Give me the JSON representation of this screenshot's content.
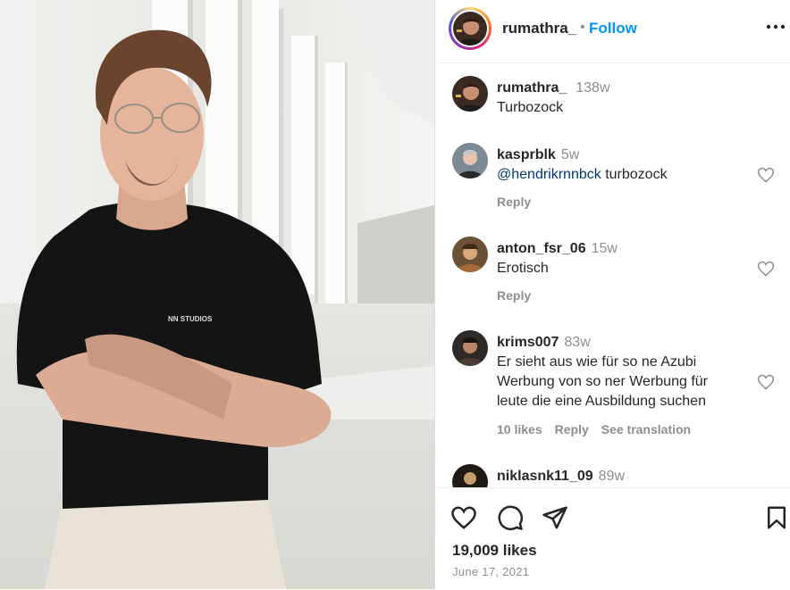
{
  "post": {
    "username": "rumathra_",
    "separator": "•",
    "follow_label": "Follow",
    "shirt_print": "NN STUDIOS"
  },
  "comments": [
    {
      "user": "rumathra_",
      "time": "138w",
      "mention": "",
      "text": "Turbozock",
      "likes": "",
      "reply": "",
      "translate": ""
    },
    {
      "user": "kasprblk",
      "time": "5w",
      "mention": "@hendrikrnnbck",
      "text": "turbozock",
      "likes": "",
      "reply": "Reply",
      "translate": ""
    },
    {
      "user": "anton_fsr_06",
      "time": "15w",
      "mention": "",
      "text": "Erotisch",
      "likes": "",
      "reply": "Reply",
      "translate": ""
    },
    {
      "user": "krims007",
      "time": "83w",
      "mention": "",
      "text": "Er sieht aus wie für so ne Azubi Werbung von so ner Werbung für leute die eine Ausbildung suchen",
      "likes": "10 likes",
      "reply": "Reply",
      "translate": "See translation"
    },
    {
      "user": "niklasnk11_09",
      "time": "89w",
      "mention": "",
      "text": "",
      "likes": "",
      "reply": "",
      "translate": ""
    }
  ],
  "footer": {
    "likes": "19,009 likes",
    "date": "June 17, 2021"
  },
  "icons": [
    "more-icon",
    "heart-icon",
    "comment-icon",
    "share-icon",
    "bookmark-icon"
  ],
  "colors": {
    "link": "#0095f6",
    "mention": "#00376b",
    "muted": "#8e8e8e",
    "text": "#262626"
  }
}
